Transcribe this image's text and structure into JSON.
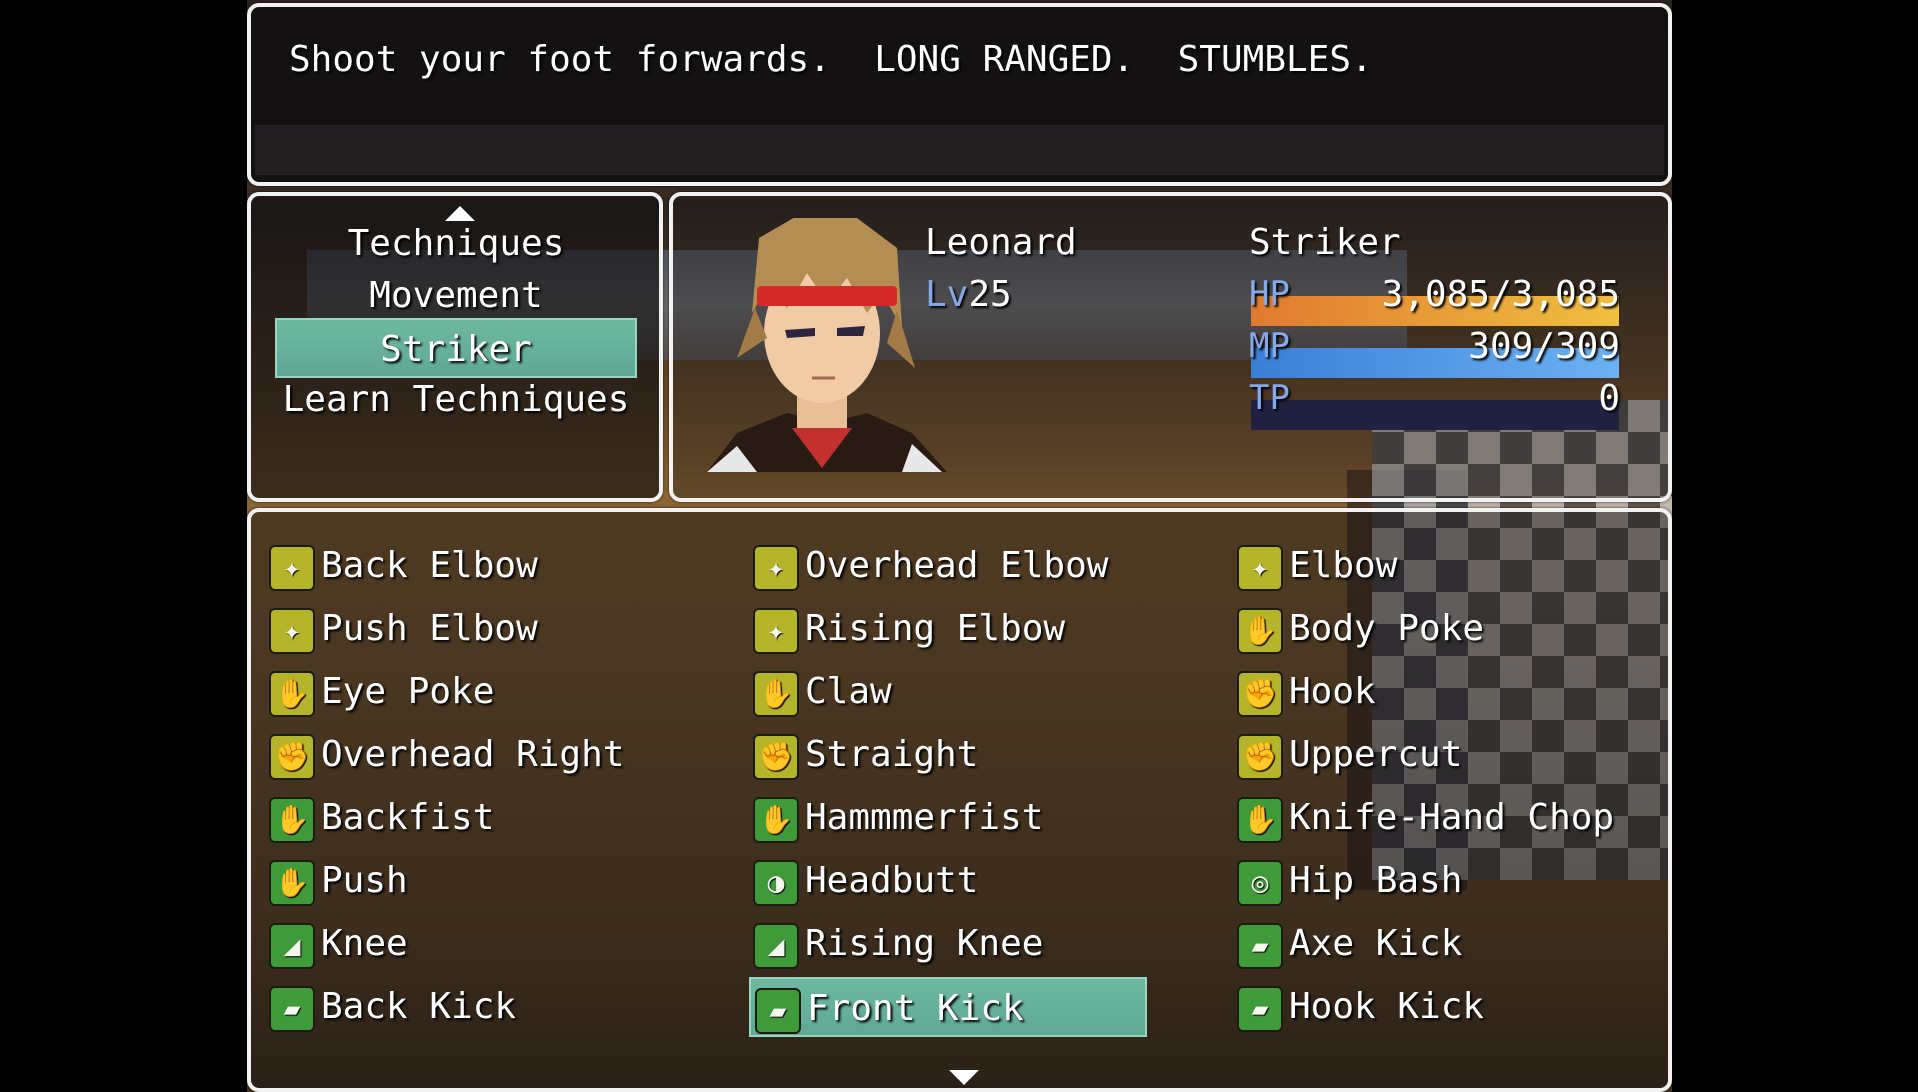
{
  "help": {
    "text": "Shoot your foot forwards.  LONG RANGED.  STUMBLES."
  },
  "commands": [
    {
      "label": "Techniques",
      "selected": false
    },
    {
      "label": "Movement",
      "selected": false
    },
    {
      "label": "Striker",
      "selected": true
    },
    {
      "label": "Learn Techniques",
      "selected": false
    }
  ],
  "actor": {
    "name": "Leonard",
    "class": "Striker",
    "level_label": "Lv",
    "level": "25",
    "hp_label": "HP",
    "hp": "3,085/3,085",
    "hp_fraction": 1.0,
    "mp_label": "MP",
    "mp": "309/309",
    "mp_fraction": 1.0,
    "tp_label": "TP",
    "tp": "0",
    "tp_fraction": 0.0
  },
  "colors": {
    "hp_start": "#e07a30",
    "hp_end": "#f0c040",
    "mp_start": "#3a7fd6",
    "mp_end": "#6cb2f2",
    "selection": "#6fb9a1",
    "system_text": "#84a8e8",
    "icon_yellow": "#b4b52a",
    "icon_green": "#3f9a3a"
  },
  "skills": [
    {
      "label": "Back Elbow",
      "icon": "elbow-icon",
      "color": "yellow"
    },
    {
      "label": "Overhead Elbow",
      "icon": "elbow-icon",
      "color": "yellow"
    },
    {
      "label": "Elbow",
      "icon": "elbow-icon",
      "color": "yellow"
    },
    {
      "label": "Push Elbow",
      "icon": "elbow-icon",
      "color": "yellow"
    },
    {
      "label": "Rising Elbow",
      "icon": "elbow-icon",
      "color": "yellow"
    },
    {
      "label": "Body Poke",
      "icon": "open-hand-icon",
      "color": "yellow"
    },
    {
      "label": "Eye Poke",
      "icon": "open-hand-icon",
      "color": "yellow"
    },
    {
      "label": "Claw",
      "icon": "open-hand-icon",
      "color": "yellow"
    },
    {
      "label": "Hook",
      "icon": "fist-icon",
      "color": "yellow"
    },
    {
      "label": "Overhead Right",
      "icon": "fist-icon",
      "color": "yellow"
    },
    {
      "label": "Straight",
      "icon": "fist-icon",
      "color": "yellow"
    },
    {
      "label": "Uppercut",
      "icon": "fist-icon",
      "color": "yellow"
    },
    {
      "label": "Backfist",
      "icon": "palm-icon",
      "color": "green"
    },
    {
      "label": "Hammmerfist",
      "icon": "palm-icon",
      "color": "green"
    },
    {
      "label": "Knife-Hand Chop",
      "icon": "palm-icon",
      "color": "green"
    },
    {
      "label": "Push",
      "icon": "palm-icon",
      "color": "green"
    },
    {
      "label": "Headbutt",
      "icon": "head-icon",
      "color": "green"
    },
    {
      "label": "Hip Bash",
      "icon": "hip-icon",
      "color": "green"
    },
    {
      "label": "Knee",
      "icon": "knee-icon",
      "color": "green"
    },
    {
      "label": "Rising Knee",
      "icon": "knee-icon",
      "color": "green"
    },
    {
      "label": "Axe Kick",
      "icon": "foot-icon",
      "color": "green"
    },
    {
      "label": "Back Kick",
      "icon": "foot-icon",
      "color": "green"
    },
    {
      "label": "Front Kick",
      "icon": "foot-icon",
      "color": "green",
      "selected": true
    },
    {
      "label": "Hook Kick",
      "icon": "foot-icon",
      "color": "green"
    }
  ]
}
